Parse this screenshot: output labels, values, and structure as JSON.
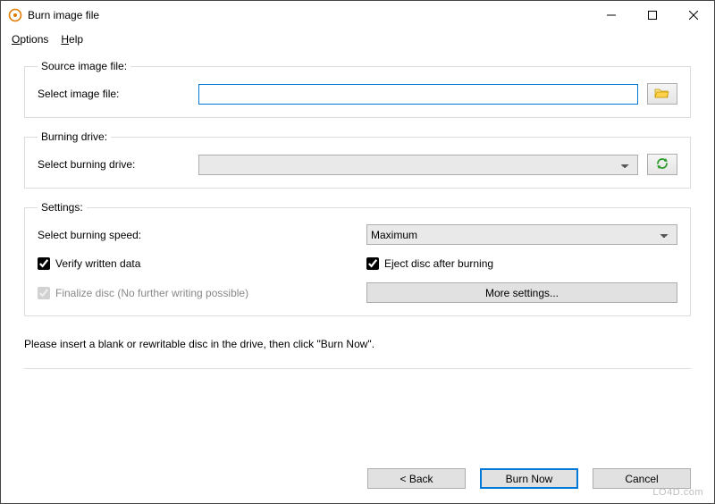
{
  "titlebar": {
    "title": "Burn image file"
  },
  "menubar": {
    "options": "Options",
    "help": "Help",
    "options_accel": "O",
    "help_accel": "H",
    "options_rest": "ptions",
    "help_rest": "elp"
  },
  "source_group": {
    "legend": "Source image file:",
    "label": "Select image file:",
    "value": "",
    "browse_icon": "folder-open"
  },
  "drive_group": {
    "legend": "Burning drive:",
    "label": "Select burning drive:",
    "selected": "",
    "refresh_icon": "refresh"
  },
  "settings_group": {
    "legend": "Settings:",
    "speed_label": "Select burning speed:",
    "speed_selected": "Maximum",
    "verify_label": "Verify written data",
    "verify_checked": true,
    "eject_label": "Eject disc after burning",
    "eject_checked": true,
    "finalize_label": "Finalize disc (No further writing possible)",
    "finalize_checked": true,
    "finalize_disabled": true,
    "more_settings": "More settings..."
  },
  "instruction": "Please insert a blank or rewritable disc in the drive, then click \"Burn Now\".",
  "footer": {
    "back": "< Back",
    "burn": "Burn Now",
    "cancel": "Cancel"
  },
  "watermark": "LO4D.com"
}
